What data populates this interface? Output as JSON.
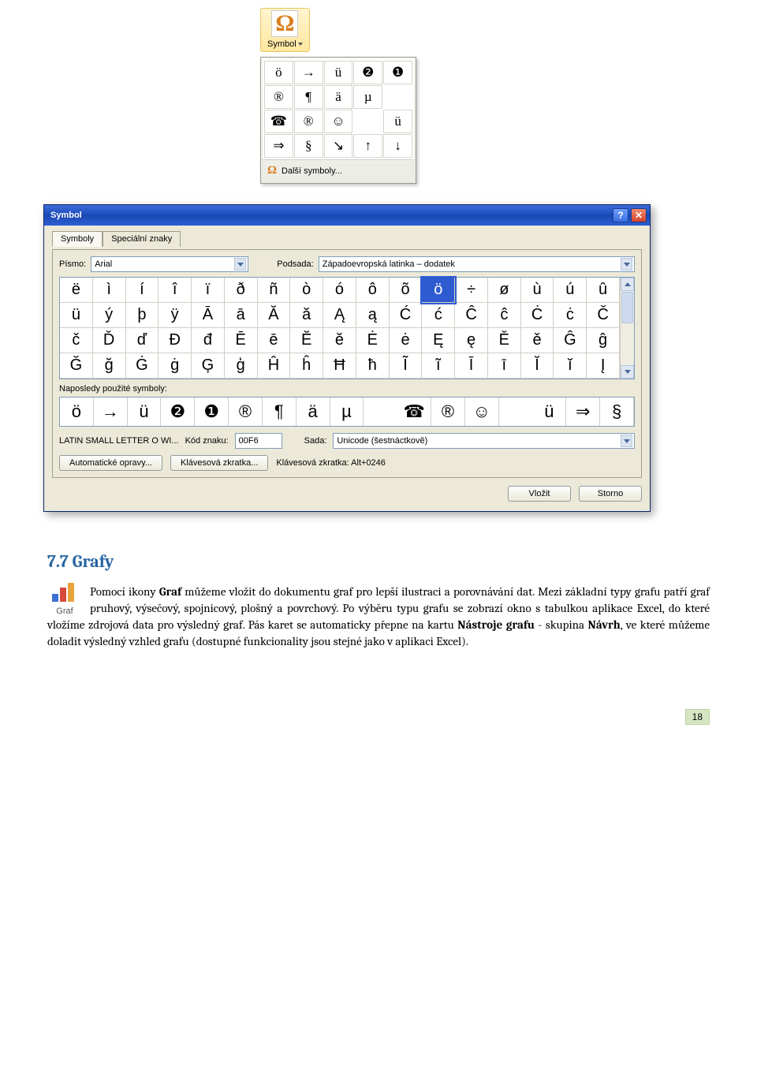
{
  "ribbon": {
    "symbol_label": "Symbol"
  },
  "dropdown": {
    "cells": [
      "ö",
      "→",
      "ü",
      "❷",
      "❶",
      "®",
      "¶",
      "ä",
      "µ",
      "",
      "☎",
      "®",
      "☺",
      "",
      "ü",
      "⇒",
      "§",
      "↘",
      "↑",
      "↓"
    ],
    "more_label": "Další symboly..."
  },
  "dialog": {
    "title": "Symbol",
    "tabs": {
      "symbols": "Symboly",
      "special": "Speciální znaky"
    },
    "font_label": "Písmo:",
    "font_value": "Arial",
    "subset_label": "Podsada:",
    "subset_value": "Západoevropská latinka – dodatek",
    "chars": [
      "ë",
      "ì",
      "í",
      "î",
      "ï",
      "ð",
      "ñ",
      "ò",
      "ó",
      "ô",
      "õ",
      "ö",
      "÷",
      "ø",
      "ù",
      "ú",
      "û",
      "ü",
      "ý",
      "þ",
      "ÿ",
      "Ā",
      "ā",
      "Ă",
      "ă",
      "Ą",
      "ą",
      "Ć",
      "ć",
      "Ĉ",
      "ĉ",
      "Ċ",
      "ċ",
      "Č",
      "č",
      "Ď",
      "ď",
      "Đ",
      "đ",
      "Ē",
      "ē",
      "Ĕ",
      "ĕ",
      "Ė",
      "ė",
      "Ę",
      "ę",
      "Ě",
      "ě",
      "Ĝ",
      "ĝ",
      "Ğ",
      "ğ",
      "Ġ",
      "ġ",
      "Ģ",
      "ģ",
      "Ĥ",
      "ĥ",
      "Ħ",
      "ħ",
      "Ĩ",
      "ĩ",
      "Ī",
      "ī",
      "Ĭ",
      "ĭ",
      "Į"
    ],
    "selected_index": 11,
    "recent_label": "Naposledy použité symboly:",
    "recent": [
      "ö",
      "→",
      "ü",
      "❷",
      "❶",
      "®",
      "¶",
      "ä",
      "µ",
      "",
      "☎",
      "®",
      "☺",
      "",
      "ü",
      "⇒",
      "§"
    ],
    "char_name": "LATIN SMALL LETTER O WI...",
    "code_label": "Kód znaku:",
    "code_value": "00F6",
    "from_label": "Sada:",
    "from_value": "Unicode (šestnáctkově)",
    "autocorrect_btn": "Automatické opravy...",
    "shortcut_btn": "Klávesová zkratka...",
    "shortcut_label": "Klávesová zkratka: Alt+0246",
    "insert_btn": "Vložit",
    "cancel_btn": "Storno"
  },
  "section": {
    "title": "7.7  Grafy",
    "icon_label": "Graf",
    "p1a": "Pomocí ikony ",
    "p1b": "Graf",
    "p1c": " můžeme vložit do dokumentu graf pro lepší ilustraci a porovnávání dat. Mezi základní typy grafu patří graf pruhový, výsečový, spojnicový, plošný a povrchový. Po výběru typu grafu se zobrazí okno s tabulkou aplikace Excel, do které vložíme zdrojová data pro výsledný graf. Pás karet se automaticky přepne na kartu ",
    "p1d": "Nástroje grafu",
    "p1e": " - skupina ",
    "p1f": "Návrh",
    "p1g": ", ve které můžeme doladit výsledný vzhled grafu (dostupné funkcionality jsou stejné jako v aplikaci Excel)."
  },
  "page_number": "18"
}
